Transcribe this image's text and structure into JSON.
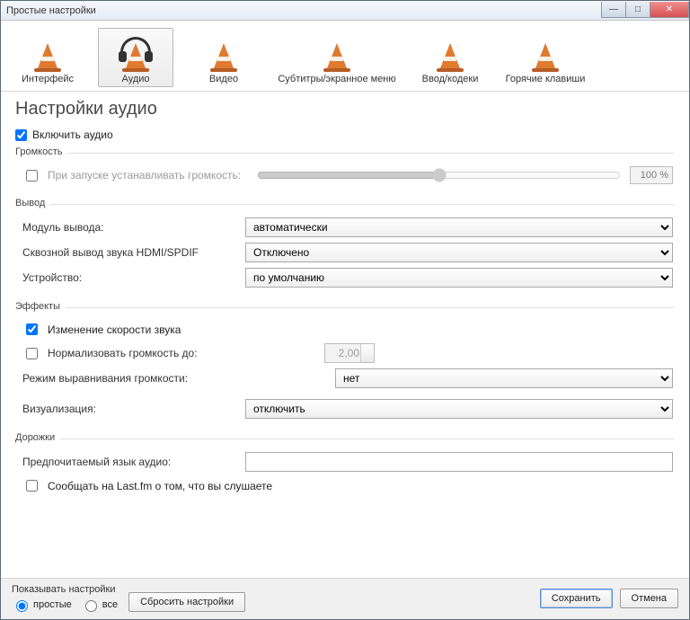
{
  "window": {
    "title": "Простые настройки"
  },
  "win_controls": {
    "min": "—",
    "max": "□",
    "close": "✕"
  },
  "categories": {
    "interface": "Интерфейс",
    "audio": "Аудио",
    "video": "Видео",
    "subs": "Субтитры/экранное меню",
    "input": "Ввод/кодеки",
    "hotkeys": "Горячие клавиши"
  },
  "page": {
    "title": "Настройки аудио",
    "enable_audio": "Включить аудио"
  },
  "volume": {
    "legend": "Громкость",
    "startup_label": "При запуске устанавливать громкость:",
    "pct": "100 %"
  },
  "output": {
    "legend": "Вывод",
    "module_label": "Модуль вывода:",
    "module_value": "автоматически",
    "spdif_label": "Сквозной вывод звука HDMI/SPDIF",
    "spdif_value": "Отключено",
    "device_label": "Устройство:",
    "device_value": "по умолчанию"
  },
  "effects": {
    "legend": "Эффекты",
    "pitch_label": "Изменение скорости звука",
    "normalize_label": "Нормализовать громкость до:",
    "normalize_value": "2,00",
    "replaygain_label": "Режим выравнивания громкости:",
    "replaygain_value": "нет",
    "visual_label": "Визуализация:",
    "visual_value": "отключить"
  },
  "tracks": {
    "legend": "Дорожки",
    "lang_label": "Предпочитаемый язык аудио:",
    "lastfm_label": "Сообщать на Last.fm о том, что вы слушаете"
  },
  "footer": {
    "show_label": "Показывать настройки",
    "radio_simple": "простые",
    "radio_all": "все",
    "reset": "Сбросить настройки",
    "save": "Сохранить",
    "cancel": "Отмена"
  }
}
